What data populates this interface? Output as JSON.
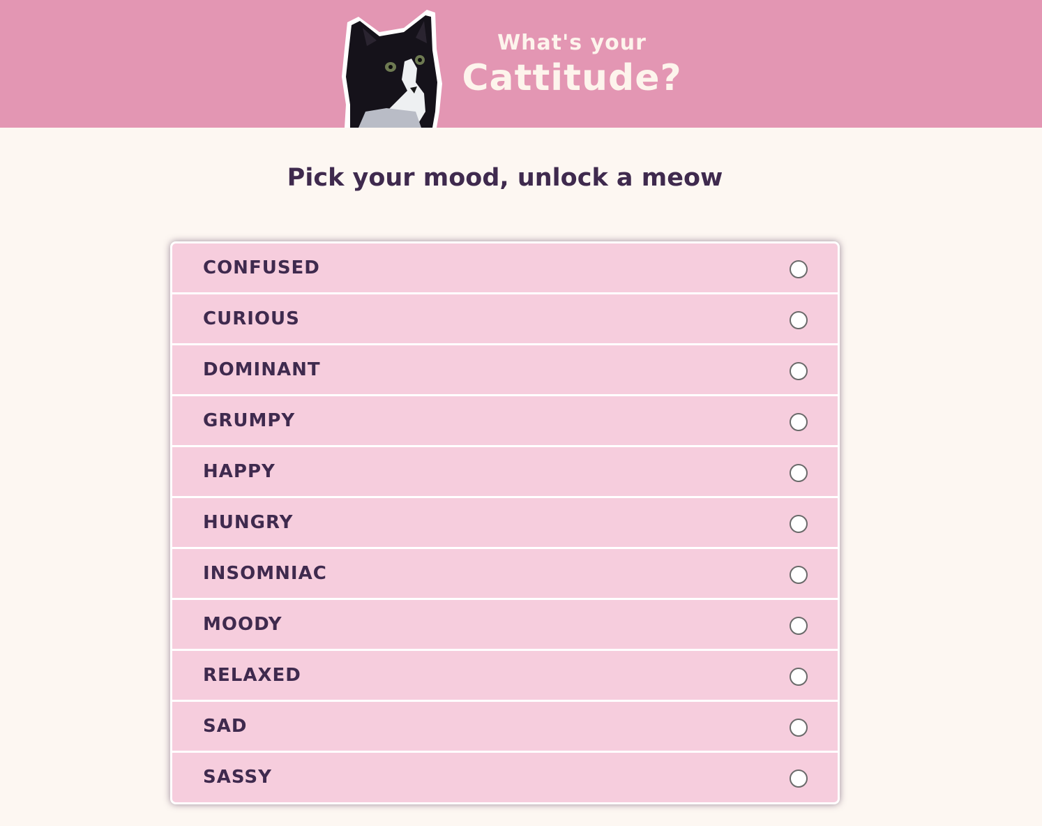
{
  "header": {
    "subtitle": "What's your",
    "title": "Cattitude?",
    "background_color": "#e396b3",
    "text_color": "#fdf4ec"
  },
  "prompt": "Pick your mood, unlock a meow",
  "moods": [
    {
      "label": "CONFUSED",
      "selected": false
    },
    {
      "label": "CURIOUS",
      "selected": false
    },
    {
      "label": "DOMINANT",
      "selected": false
    },
    {
      "label": "GRUMPY",
      "selected": false
    },
    {
      "label": "HAPPY",
      "selected": false
    },
    {
      "label": "HUNGRY",
      "selected": false
    },
    {
      "label": "INSOMNIAC",
      "selected": false
    },
    {
      "label": "MOODY",
      "selected": false
    },
    {
      "label": "RELAXED",
      "selected": false
    },
    {
      "label": "SAD",
      "selected": false
    },
    {
      "label": "SASSY",
      "selected": false
    }
  ],
  "colors": {
    "page_background": "#fdf7f2",
    "item_background": "#f6cddd",
    "text": "#3f2a4e"
  },
  "icons": {
    "header_image": "tuxedo-cat-photo",
    "option_marker": "radio-circle"
  }
}
